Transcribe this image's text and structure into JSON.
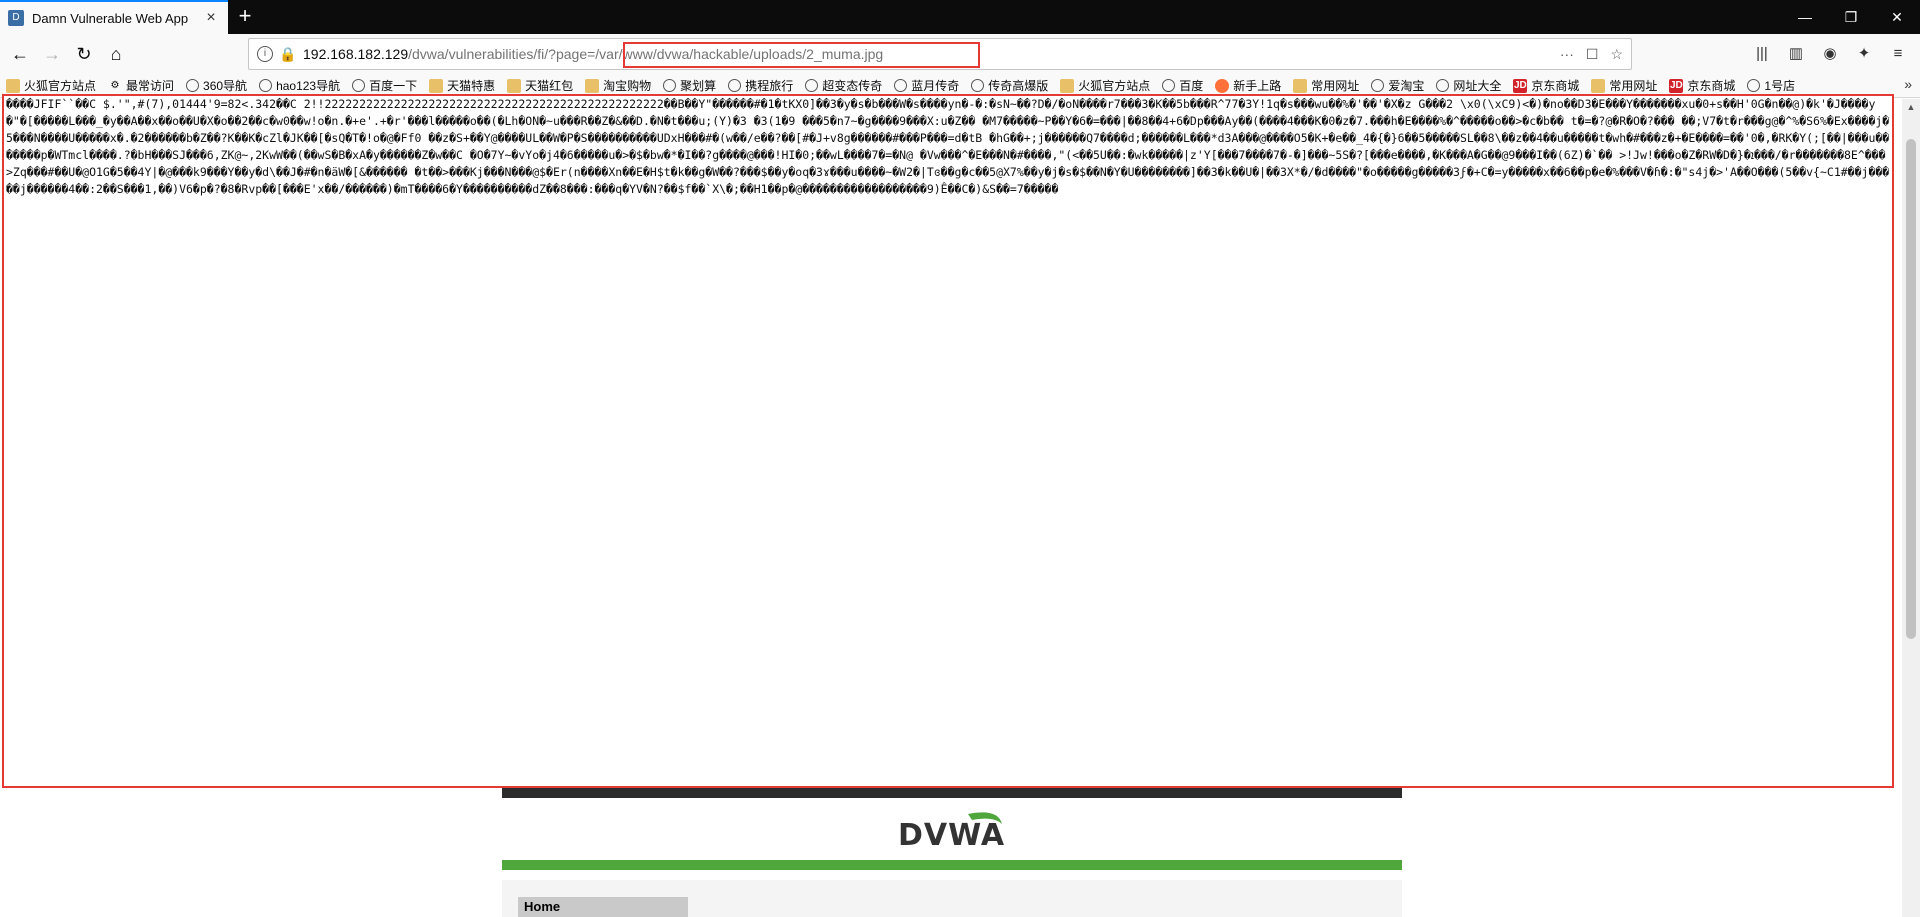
{
  "browser": {
    "tab_title": "Damn Vulnerable Web App",
    "new_tab_label": "+",
    "url_host": "192.168.182.129",
    "url_path": "/dvwa/vulnerabilities/fi/?page=/var/www/dvwa/hackable/uploads/2_muma.jpg",
    "url_actions": [
      "···",
      "☐",
      "☆"
    ],
    "accent_color": "#0a84ff",
    "highlight_color": "#e53935"
  },
  "bookmarks": [
    {
      "label": "火狐官方站点",
      "icon": "folder"
    },
    {
      "label": "最常访问",
      "icon": "gear"
    },
    {
      "label": "360导航",
      "icon": "globe"
    },
    {
      "label": "hao123导航",
      "icon": "globe"
    },
    {
      "label": "百度一下",
      "icon": "globe"
    },
    {
      "label": "天猫特惠",
      "icon": "folder"
    },
    {
      "label": "天猫红包",
      "icon": "folder"
    },
    {
      "label": "淘宝购物",
      "icon": "folder"
    },
    {
      "label": "聚划算",
      "icon": "globe"
    },
    {
      "label": "携程旅行",
      "icon": "globe"
    },
    {
      "label": "超变态传奇",
      "icon": "globe"
    },
    {
      "label": "蓝月传奇",
      "icon": "globe"
    },
    {
      "label": "传奇高爆版",
      "icon": "globe"
    },
    {
      "label": "火狐官方站点",
      "icon": "folder"
    },
    {
      "label": "百度",
      "icon": "globe"
    },
    {
      "label": "新手上路",
      "icon": "fox"
    },
    {
      "label": "常用网址",
      "icon": "folder"
    },
    {
      "label": "爱淘宝",
      "icon": "globe"
    },
    {
      "label": "网址大全",
      "icon": "globe"
    },
    {
      "label": "京东商城",
      "icon": "jd"
    },
    {
      "label": "常用网址",
      "icon": "folder"
    },
    {
      "label": "京东商城",
      "icon": "jd"
    },
    {
      "label": "1号店",
      "icon": "globe"
    }
  ],
  "bookmarks_more": "»",
  "garbled_output": "����JFIF``��C $.'\",#(7),01444'9=82<.342��C 2!!2222222222222222222222222222222222222222222222222��B��Y\"������#�1�tKX0]��3�y�s�b���W�s����yn�-�:�sN~��?D�/�oN����r7���3�K��5b���R^77�3Y!1q�s���wu��%�'��'�X�z G���2 \\x0(\\xC9)<�)�no��D3�E���Y�������xu�0+s��H'0G�n��@)�k'�J����y�\"�[�����L���_�y��A��x��o��U�X�o��2��c�w0��w!o�n.�+e'.+�r'���l�����o��(�Lh�ON�~u���R��Z�&��D.�N�t���u;(Y)�3 �3(1�9 ���5�n7~�g����9���X:u�Z�� �M7�����~P��Y�6�=���|��8��4+6�Dp���Ay��(����4���K�0�z�7.���h�E����%�^�����o��>�c�b�� t�=�?@�R�O�?��� ��;V7�t�r���g@�^%�S6%�Ex����j�5���N����U�����x�.�2������b�Z��?K��K�cZl�JK��[�sQ�T�!o�@�Ff0 ��z�S+��Y@����UL��W�P�S����������UDxH���#�(w��/e��?��[#�J+v8g������#���P���=d�tB �hG��+;j������Q7����d;������L���*d3A���@����O5�K+�e��_4�{�}6��5�����SL��8\\��z��4��u�����t�wh�#���z�+�E����=��'0�,�RK�Y(;[��|���u�������p�WTmcl����.?�bH���SJ���6,ZK@~,2KwW��(��wS�B�xA�y������Z�w��C �O�7Y~�vYo�j4�6�����u�>�$�bw�*�I��?g����@���!HI�0;��wL����7�=�N@ �Vw���^�E���N�#����,\"(<��5U��:�wk�����|z'Y[���7����7�-�]���~5S�?[���e����,�K���A�G��@9���I��(6Z)�`�� >!Jw!���o�Z�RW�D�}�ܐ���/�r�������8E^���>Zq���#��U�@O1G�5��4Y|�@���k9���Y��y�d\\��J�#�n�ӓW�[&������ �t��>���Kj���N���@$�Er(n����Xn��E�H$t�k��g�W��?���$��y�oq�3ɤ���u����~�W2�|Tɞ��g�c��5@X7%��y�j�s�$��N�Y�U��������]��3�k��U�|��3X*�/�d����\"�o�����g�����3ϝ�+C�=y�����x��6��p�e�%���V�ɦ�:�\"s4j�>'A��O���(5��v{~C1#��j�����j������4��:2��S���1,��)V6�p�?�8�Rvp��[���E'x��/������)�mT����6�Y����������dZ��8���:���q�YV�N?��$f��`X\\�;��H1��p�@������������������9)Ê��C�)&S��=7�����",
  "dvwa": {
    "logo_text": "DVWA",
    "menu_home": "Home",
    "header_color": "#4fa63b"
  }
}
